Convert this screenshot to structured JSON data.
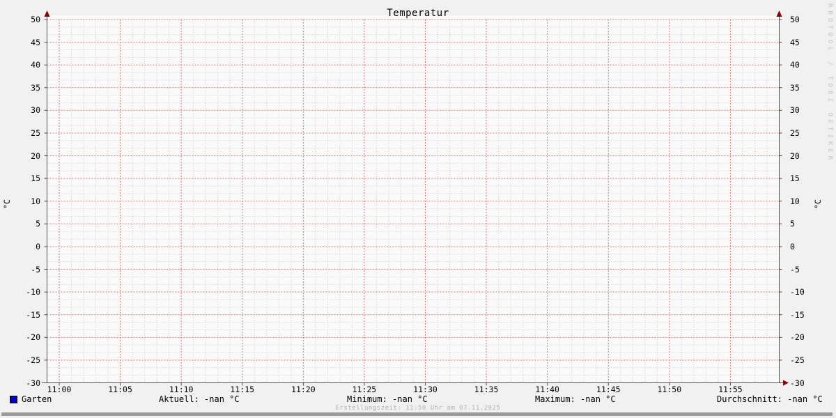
{
  "title": "Temperatur",
  "watermark": "RRDTOOL / TOBI OETIKER",
  "footer": {
    "creation_text": "Erstellungszeit: 11:50 Uhr am 07.11.2025"
  },
  "legend": {
    "series_label": "Garten",
    "series_color": "#0000cc",
    "stats": [
      "Aktuell: -nan °C",
      "Minimum: -nan °C",
      "Maximum: -nan °C",
      "Durchschnitt: -nan °C"
    ]
  },
  "chart_data": {
    "type": "line",
    "title": "Temperatur",
    "xlabel": "",
    "ylabel": "°C",
    "ylabel_right": "°C",
    "ylim": [
      -30,
      50
    ],
    "y_major_step": 5,
    "y_ticks": [
      50,
      45,
      40,
      35,
      30,
      25,
      20,
      15,
      10,
      5,
      0,
      -5,
      -10,
      -15,
      -20,
      -25,
      -30
    ],
    "x_ticks": [
      "11:00",
      "11:05",
      "11:10",
      "11:15",
      "11:20",
      "11:25",
      "11:30",
      "11:35",
      "11:40",
      "11:45",
      "11:50",
      "11:55"
    ],
    "x_minor_per_major": 5,
    "y_minor_per_major": 3,
    "grid": "on",
    "legend_position": "bottom",
    "series": [
      {
        "name": "Garten",
        "color": "#0000cc",
        "values": []
      }
    ],
    "colors": {
      "background": "#f1f1f1",
      "canvas": "#fafafa",
      "major_grid": "#dd7777",
      "minor_grid": "#cccccc",
      "axis": "#4d4d4d",
      "arrow": "#8b0000"
    }
  }
}
